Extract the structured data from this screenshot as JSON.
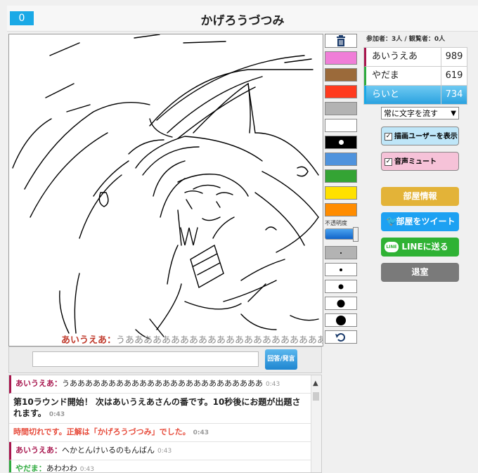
{
  "header": {
    "score": "0",
    "title": "かげろうづつみ"
  },
  "canvas": {
    "live_message": {
      "author": "あいうえあ",
      "separator": "：",
      "text": "うあああああああああああああああああああああああああ"
    }
  },
  "palette": {
    "colors": [
      "#f07ed8",
      "#9b6a3a",
      "#ff3a1e",
      "#b3b3b3",
      "#ffffff",
      "#000000",
      "#4f93dd",
      "#34a434",
      "#ffe100",
      "#ff8c00"
    ],
    "opacity_label": "不透明度"
  },
  "sidebar": {
    "counts": "参加者：3人 / 観覧者：0人",
    "players": [
      {
        "name": "あいうえあ",
        "score": "989",
        "color": "#a8164e"
      },
      {
        "name": "やだま",
        "score": "619",
        "color": "#2eaa3e"
      },
      {
        "name": "らいと",
        "score": "734",
        "color": "#1aa9e6"
      }
    ],
    "flow_select": "常に文字を流す",
    "show_drawer": "描画ユーザーを表示",
    "mute": "音声ミュート",
    "room_info": "部屋情報",
    "tweet": "部屋をツイート",
    "line": "LINEに送る",
    "exit": "退室"
  },
  "chat_input": {
    "send_label": "回答/発言"
  },
  "chat": {
    "messages": [
      {
        "type": "user",
        "author": "あいうえあ",
        "text": "うあああああああああああああああああああああああああ",
        "time": "0:43"
      },
      {
        "type": "sys",
        "text": "第10ラウンド開始！ 次はあいうえあさんの番です。10秒後にお題が出題されます。",
        "time": "0:43"
      },
      {
        "type": "warn",
        "text": "時間切れです。正解は「かげろうづつみ」でした。",
        "time": "0:43"
      },
      {
        "type": "user",
        "author": "あいうえあ",
        "text": "へかとんけいるのもんばん",
        "time": "0:43"
      },
      {
        "type": "user2",
        "author": "やだま",
        "text": "あわわわ",
        "time": "0:43"
      }
    ]
  },
  "colors": {
    "accent": "#1aa9e6",
    "room_info": "#e3b338",
    "tweet": "#1da1f2",
    "line": "#2fb234",
    "exit": "#7a7a7a"
  }
}
